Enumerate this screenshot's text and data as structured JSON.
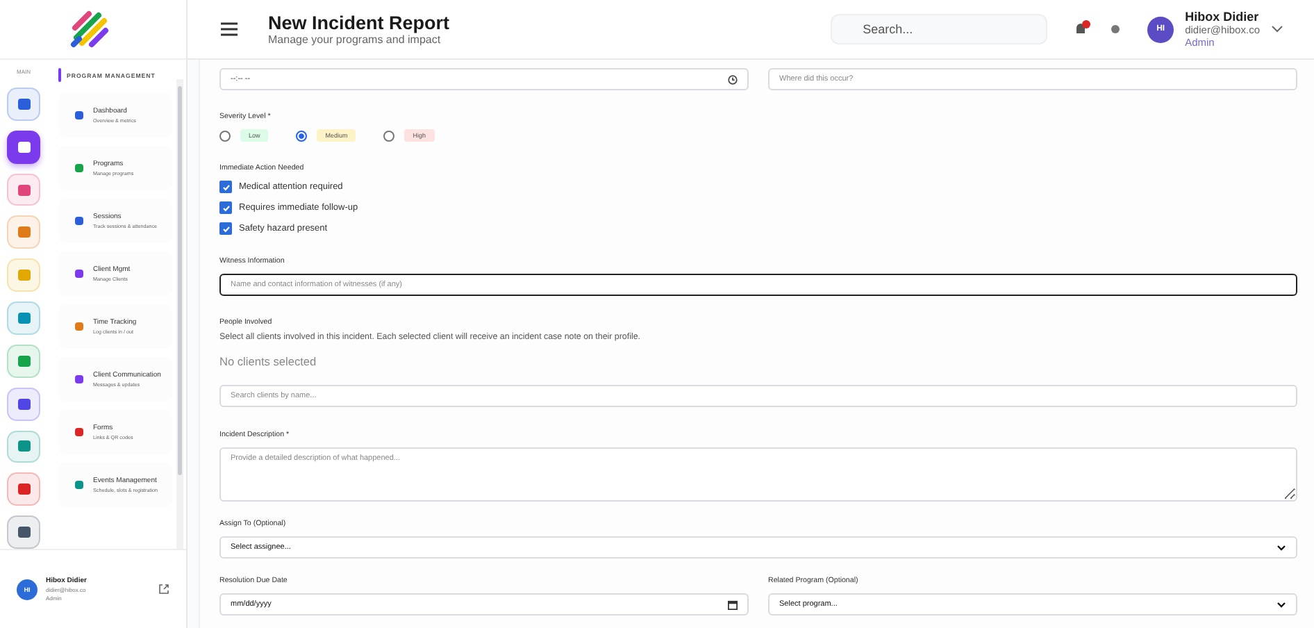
{
  "rail": {
    "label": "MAIN",
    "items": [
      {
        "color": "#2b5fd9",
        "selected": false
      },
      {
        "color": "#7c3aed",
        "selected": true
      },
      {
        "color": "#e0457b",
        "selected": false
      },
      {
        "color": "#e07b1a",
        "selected": false
      },
      {
        "color": "#e0a800",
        "selected": false
      },
      {
        "color": "#0891b2",
        "selected": false
      },
      {
        "color": "#16a34a",
        "selected": false
      },
      {
        "color": "#4f46e5",
        "selected": false
      },
      {
        "color": "#0d9488",
        "selected": false
      },
      {
        "color": "#dc2626",
        "selected": false
      },
      {
        "color": "#475569",
        "selected": false
      }
    ]
  },
  "submenu": {
    "title": "PROGRAM MANAGEMENT",
    "items": [
      {
        "title": "Dashboard",
        "subtitle": "Overview & metrics",
        "color": "#2b5fd9"
      },
      {
        "title": "Programs",
        "subtitle": "Manage programs",
        "color": "#16a34a"
      },
      {
        "title": "Sessions",
        "subtitle": "Track sessions & attendance",
        "color": "#2b5fd9"
      },
      {
        "title": "Client Mgmt",
        "subtitle": "Manage Clients",
        "color": "#7c3aed"
      },
      {
        "title": "Time Tracking",
        "subtitle": "Log clients in / out",
        "color": "#e07b1a"
      },
      {
        "title": "Client Communication",
        "subtitle": "Messages & updates",
        "color": "#7c3aed"
      },
      {
        "title": "Forms",
        "subtitle": "Links & QR codes",
        "color": "#dc2626"
      },
      {
        "title": "Events Management",
        "subtitle": "Schedule, slots & registration",
        "color": "#0d9488"
      }
    ]
  },
  "user_footer": {
    "initials": "HI",
    "name": "Hibox Didier",
    "email": "didier@hibox.co",
    "role": "Admin"
  },
  "header": {
    "title": "New Incident Report",
    "subtitle": "Manage your programs and impact",
    "search": {
      "placeholder": "Search..."
    },
    "user": {
      "initials": "HI",
      "name": "Hibox Didier",
      "email": "didier@hibox.co",
      "role": "Admin"
    }
  },
  "form": {
    "time_field": {
      "value": "--:-- --"
    },
    "location_field": {
      "placeholder": "Where did this occur?"
    },
    "severity": {
      "label": "Severity Level *",
      "options": [
        {
          "label": "Low",
          "color": "#dcfce7",
          "selected": false
        },
        {
          "label": "Medium",
          "color": "#fef3c7",
          "selected": true
        },
        {
          "label": "High",
          "color": "#fee2e2",
          "selected": false
        }
      ]
    },
    "actions": {
      "label": "Immediate Action Needed",
      "items": [
        {
          "label": "Medical attention required",
          "checked": true
        },
        {
          "label": "Requires immediate follow-up",
          "checked": true
        },
        {
          "label": "Safety hazard present",
          "checked": true
        }
      ]
    },
    "witness": {
      "label": "Witness Information",
      "placeholder": "Name and contact information of witnesses (if any)"
    },
    "people": {
      "label": "People Involved",
      "help": "Select all clients involved in this incident. Each selected client will receive an incident case note on their profile.",
      "empty": "No clients selected",
      "search_placeholder": "Search clients by name..."
    },
    "description": {
      "label": "Incident Description *",
      "placeholder": "Provide a detailed description of what happened..."
    },
    "assign": {
      "label": "Assign To (Optional)",
      "value": "Select assignee..."
    },
    "due_date": {
      "label": "Resolution Due Date",
      "value": "mm/dd/yyyy"
    },
    "program": {
      "label": "Related Program (Optional)",
      "value": "Select program..."
    }
  }
}
